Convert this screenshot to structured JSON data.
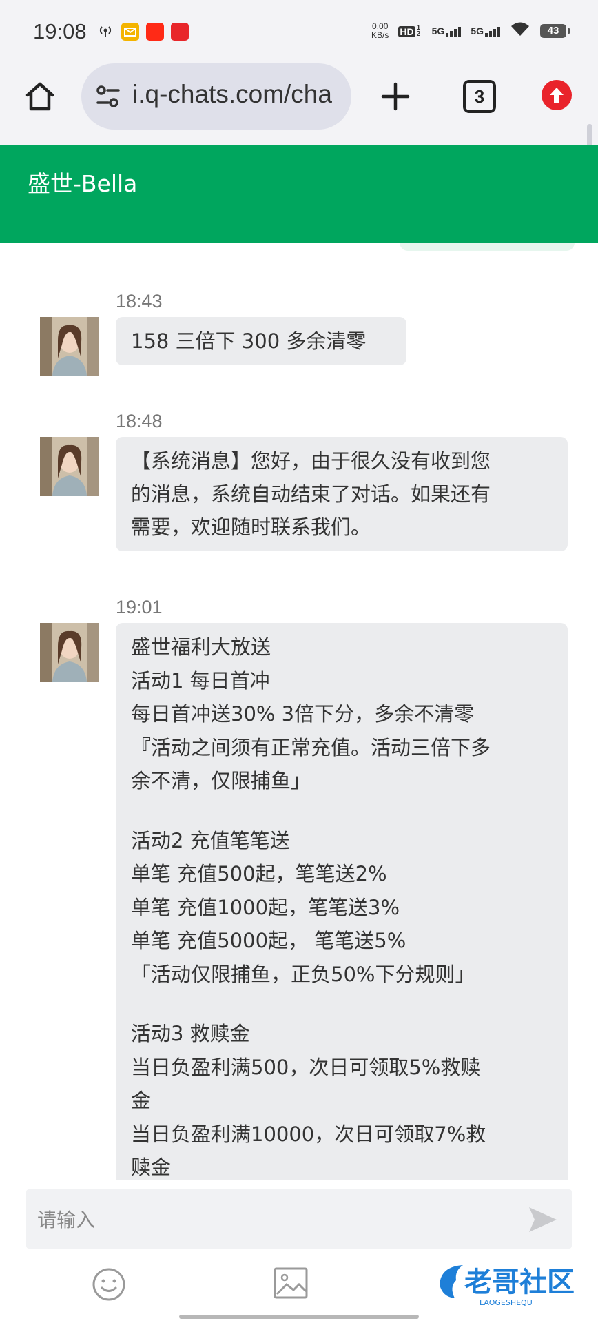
{
  "status_bar": {
    "time": "19:08",
    "net_speed_value": "0.00",
    "net_speed_unit": "KB/s",
    "hd_label": "HD",
    "hd_sub": "1 2",
    "sim1": "5G",
    "sim2": "5G",
    "battery": "43",
    "icons": [
      "hotspot-icon",
      "mail-app-icon",
      "taobao-app-icon",
      "gift-app-icon",
      "wifi-icon"
    ]
  },
  "browser": {
    "url": "i.q-chats.com/cha",
    "tab_count": "3",
    "icons": [
      "home-icon",
      "site-settings-icon",
      "plus-icon",
      "upload-icon"
    ]
  },
  "chat": {
    "title": "盛世-Bella",
    "messages": [
      {
        "time": "18:43",
        "lines": [
          "158 三倍下 300 多余清零"
        ]
      },
      {
        "time": "18:48",
        "lines": [
          "【系统消息】您好，由于很久没有收到您",
          "的消息，系统自动结束了对话。如果还有",
          "需要，欢迎随时联系我们。"
        ]
      },
      {
        "time": "19:01",
        "lines": [
          "盛世福利大放送",
          "活动1 每日首冲",
          "每日首冲送30% 3倍下分，多余不清零",
          "『活动之间须有正常充值。活动三倍下多",
          "余不清，仅限捕鱼」",
          "",
          "活动2 充值笔笔送",
          "单笔 充值500起，笔笔送2%",
          "单笔 充值1000起，笔笔送3%",
          "单笔 充值5000起， 笔笔送5%",
          "「活动仅限捕鱼，正负50%下分规则」",
          "",
          "活动3 救赎金",
          "当日负盈利满500，次日可领取5%救赎",
          "金",
          "当日负盈利满10000，次日可领取7%救",
          "赎金"
        ]
      }
    ]
  },
  "input": {
    "placeholder": "请输入",
    "icons": [
      "send-icon",
      "emoji-icon",
      "image-icon"
    ]
  },
  "watermark": {
    "text_cn": "老哥社区",
    "text_en": "LAOGESHEQU"
  },
  "colors": {
    "header_green": "#00a65e",
    "bubble_gray": "#ebecee",
    "browser_bg": "#f3f3f6"
  }
}
